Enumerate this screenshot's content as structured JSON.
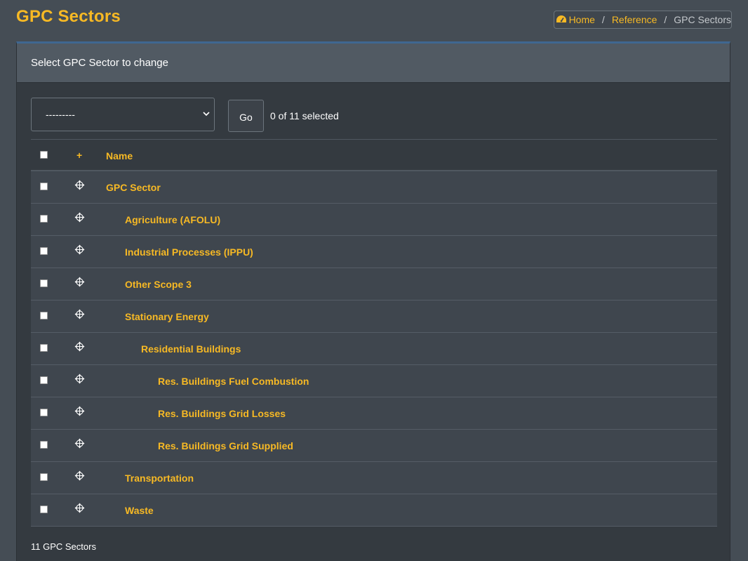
{
  "page": {
    "title": "GPC Sectors"
  },
  "breadcrumb": {
    "home": "Home",
    "reference": "Reference",
    "current": "GPC Sectors",
    "separator": "/"
  },
  "card": {
    "header": "Select GPC Sector to change"
  },
  "actions": {
    "select_value": "---------",
    "go_label": "Go",
    "selected_count": "0 of 11 selected"
  },
  "table": {
    "headers": {
      "add": "+",
      "name": "Name"
    },
    "rows": [
      {
        "name": "GPC Sector",
        "level": 0
      },
      {
        "name": "Agriculture (AFOLU)",
        "level": 1
      },
      {
        "name": "Industrial Processes (IPPU)",
        "level": 1
      },
      {
        "name": "Other Scope 3",
        "level": 1
      },
      {
        "name": "Stationary Energy",
        "level": 1
      },
      {
        "name": "Residential Buildings",
        "level": 2
      },
      {
        "name": "Res. Buildings Fuel Combustion",
        "level": 3
      },
      {
        "name": "Res. Buildings Grid Losses",
        "level": 3
      },
      {
        "name": "Res. Buildings Grid Supplied",
        "level": 3
      },
      {
        "name": "Transportation",
        "level": 1
      },
      {
        "name": "Waste",
        "level": 1
      }
    ]
  },
  "footer": {
    "count": "11 GPC Sectors"
  },
  "icons": {
    "home": "tachometer-icon",
    "drag": "move-icon"
  },
  "colors": {
    "accent": "#f7b924",
    "background": "#454d55",
    "card": "#343a40"
  }
}
